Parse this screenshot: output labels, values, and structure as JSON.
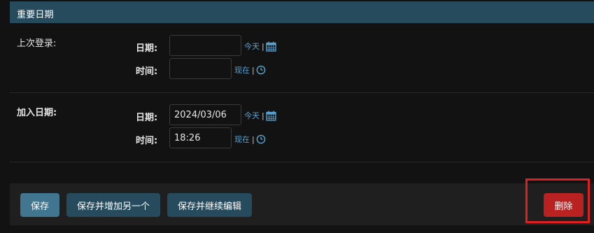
{
  "section": {
    "title": "重要日期"
  },
  "last_login": {
    "label": "上次登录:",
    "date_label": "日期:",
    "date_value": "",
    "today_link": "今天",
    "separator": "|",
    "time_label": "时间:",
    "time_value": "",
    "now_link": "现在"
  },
  "date_joined": {
    "label": "加入日期:",
    "date_label": "日期:",
    "date_value": "2024/03/06",
    "today_link": "今天",
    "separator": "|",
    "time_label": "时间:",
    "time_value": "18:26",
    "now_link": "现在"
  },
  "actions": {
    "save": "保存",
    "save_add_another": "保存并增加另一个",
    "save_continue": "保存并继续编辑",
    "delete": "删除"
  },
  "icons": {
    "calendar": "calendar-icon",
    "clock": "clock-icon"
  },
  "colors": {
    "header_bg": "#264b5d",
    "link": "#5aa3d0",
    "primary_button": "#417690",
    "secondary_button": "#264b5d",
    "delete_button": "#ba2121",
    "highlight": "#e02020"
  }
}
